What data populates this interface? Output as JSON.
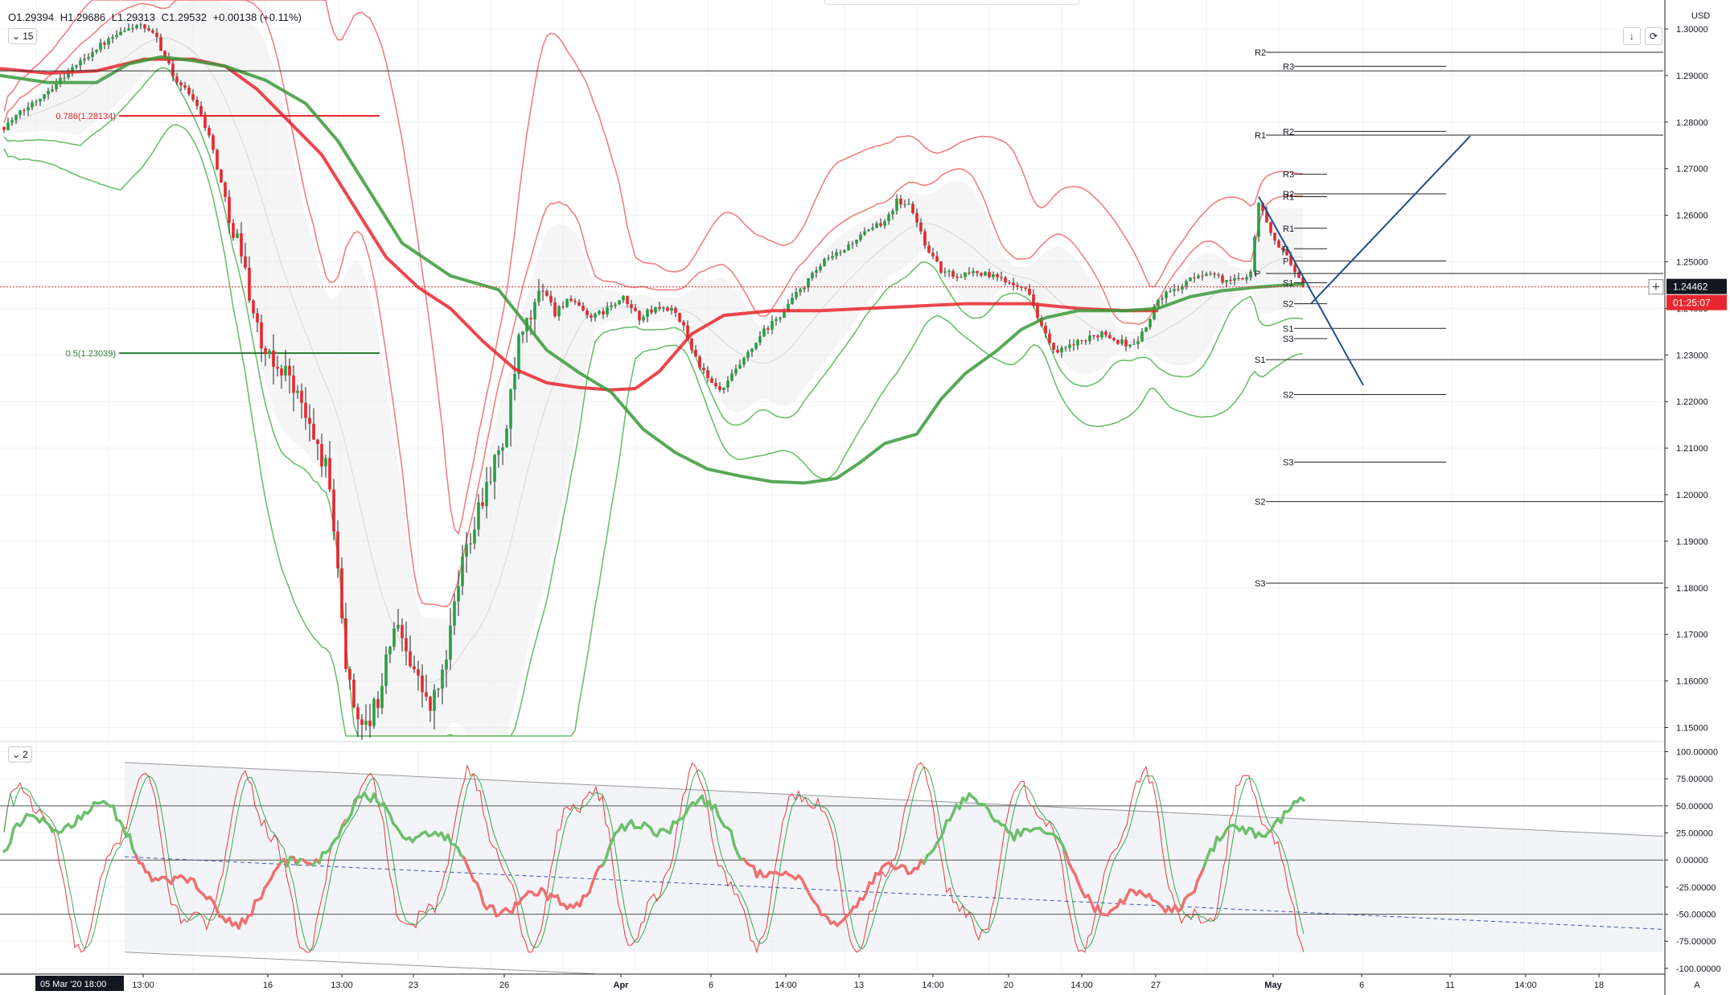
{
  "legend": {
    "open": "O1.29394",
    "high": "H1.29686",
    "low": "L1.29313",
    "close": "C1.29532",
    "change": "+0.00138 (+0.11%)"
  },
  "pane1_label": "15",
  "pane2_label": "2",
  "currency": "USD",
  "corner_label": "A",
  "price_tag": "1.24462",
  "countdown_tag": "01:25:07",
  "colors": {
    "up": "#26a041",
    "down": "#e8262d",
    "red_band": "#f08080",
    "green_band": "#6cbf6c",
    "trend": "#1f4e8c"
  },
  "chart_data": [
    {
      "type": "candlestick",
      "symbol_interval": "15",
      "ylim": [
        1.148,
        1.303
      ],
      "y_ticks": [
        "1.30000",
        "1.29000",
        "1.28000",
        "1.27000",
        "1.26000",
        "1.25000",
        "1.24000",
        "1.23000",
        "1.22000",
        "1.21000",
        "1.20000",
        "1.19000",
        "1.18000",
        "1.17000",
        "1.16000",
        "1.15000"
      ],
      "x_ticks": [
        "05 Mar '20  18:00",
        "13:00",
        "16",
        "13:00",
        "23",
        "26",
        "Apr",
        "6",
        "14:00",
        "13",
        "14:00",
        "20",
        "14:00",
        "27",
        "May",
        "6",
        "11",
        "14:00",
        "18"
      ],
      "current_price": 1.24462,
      "fib_levels": [
        {
          "label": "0.786(1.28134)",
          "value": 1.28134,
          "color": "#e8262d"
        },
        {
          "label": "0.5(1.23039)",
          "value": 1.23039,
          "color": "#2e7d32"
        }
      ],
      "pivot_levels": [
        {
          "label": "R2",
          "value": 1.295
        },
        {
          "label": "R3",
          "value": 1.292
        },
        {
          "label": "R1",
          "value": 1.2772
        },
        {
          "label": "R2",
          "value": 1.278
        },
        {
          "label": "R3",
          "value": 1.2688
        },
        {
          "label": "R2",
          "value": 1.2646
        },
        {
          "label": "R1",
          "value": 1.264
        },
        {
          "label": "R1",
          "value": 1.2572
        },
        {
          "label": "P",
          "value": 1.2528
        },
        {
          "label": "P",
          "value": 1.2502
        },
        {
          "label": "P",
          "value": 1.2475
        },
        {
          "label": "S1",
          "value": 1.2455
        },
        {
          "label": "S2",
          "value": 1.241
        },
        {
          "label": "S1",
          "value": 1.2357
        },
        {
          "label": "S3",
          "value": 1.2335
        },
        {
          "label": "S1",
          "value": 1.229
        },
        {
          "label": "S2",
          "value": 1.2215
        },
        {
          "label": "S3",
          "value": 1.207
        },
        {
          "label": "S2",
          "value": 1.1985
        },
        {
          "label": "S3",
          "value": 1.181
        }
      ]
    },
    {
      "type": "line",
      "indicator": "stochastic",
      "ylim": [
        -100,
        100
      ],
      "y_ticks": [
        "100.00000",
        "75.00000",
        "50.00000",
        "25.00000",
        "0.00000",
        "-25.00000",
        "-50.00000",
        "-75.00000",
        "-100.00000"
      ],
      "levels": [
        50,
        0,
        -50
      ]
    }
  ]
}
